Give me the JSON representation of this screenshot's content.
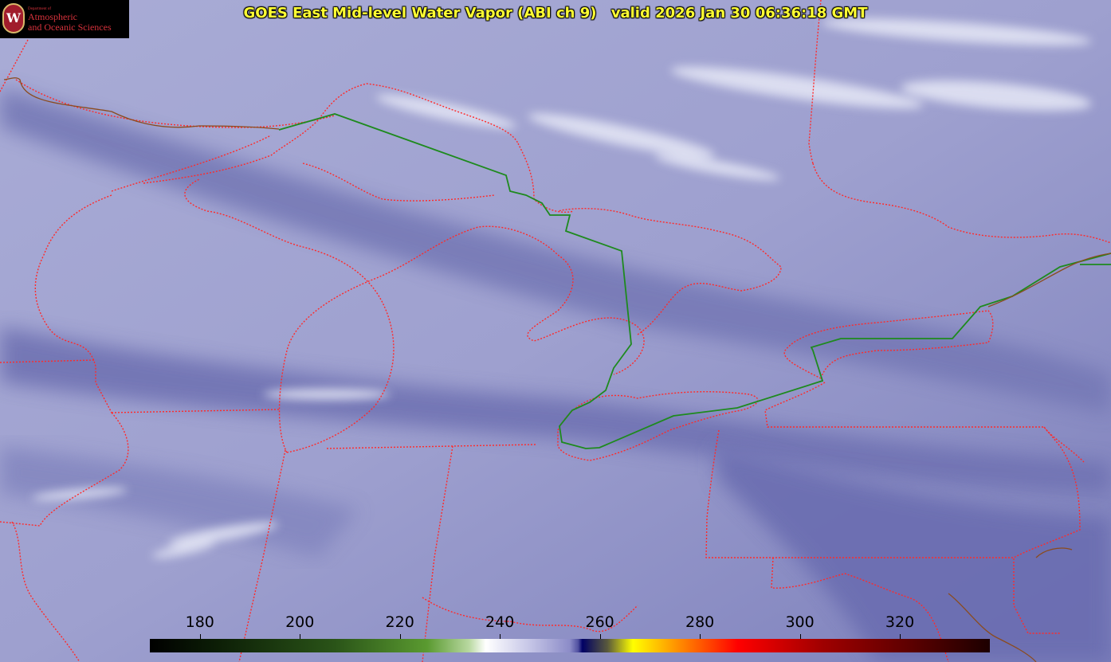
{
  "title": {
    "product": "GOES East Mid-level Water Vapor (ABI ch 9)",
    "valid": "valid 2026 Jan 30 06:36:18 GMT"
  },
  "logo": {
    "seal_letter": "W",
    "dept_line": "Department of",
    "line1": "Atmospheric",
    "line2": "and Oceanic Sciences"
  },
  "colorbar": {
    "ticks": [
      "180",
      "200",
      "220",
      "240",
      "260",
      "280",
      "300",
      "320"
    ],
    "min": 170,
    "max": 338,
    "unit_note": "",
    "colors": {
      "black": "#000000",
      "dark_green": "#1c3a10",
      "green": "#5a9a30",
      "light_green": "#c8e0a8",
      "white": "#ffffff",
      "lavender": "#b4b4dc",
      "blue": "#5a5aa8",
      "navy": "#000064",
      "yellow": "#ffff00",
      "orange": "#ff8c00",
      "red": "#ff0000",
      "dark_red": "#8c0000",
      "near_black": "#200000"
    }
  },
  "map": {
    "background": "#8d8fc4",
    "border_color": "#ff2a2a",
    "intl_border_color": "#1e8a1e"
  }
}
